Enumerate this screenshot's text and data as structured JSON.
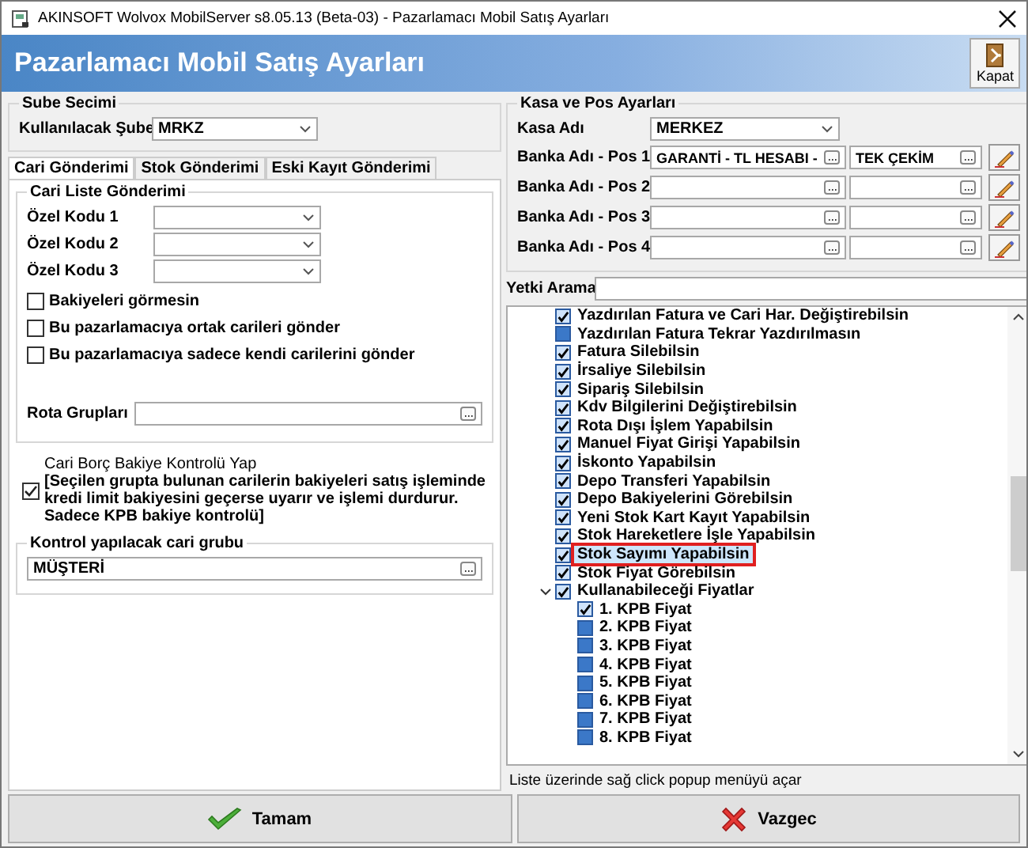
{
  "window": {
    "title": "AKINSOFT Wolvox MobilServer s8.05.13 (Beta-03) - Pazarlamacı Mobil Satış Ayarları"
  },
  "header": {
    "title": "Pazarlamacı Mobil Satış Ayarları",
    "close_button": "Kapat"
  },
  "branch": {
    "group": "Sube Secimi",
    "label": "Kullanılacak Şube",
    "value": "MRKZ"
  },
  "tabs": [
    {
      "label": "Cari Gönderimi",
      "selected": true
    },
    {
      "label": "Stok Gönderimi",
      "selected": false
    },
    {
      "label": "Eski Kayıt Gönderimi",
      "selected": false
    }
  ],
  "customer_list": {
    "group": "Cari Liste Gönderimi",
    "codes": [
      {
        "label": "Özel Kodu 1"
      },
      {
        "label": "Özel Kodu 2"
      },
      {
        "label": "Özel Kodu 3"
      }
    ],
    "options": [
      {
        "label": "Bakiyeleri görmesin",
        "checked": false
      },
      {
        "label": "Bu pazarlamacıya ortak carileri gönder",
        "checked": false
      },
      {
        "label": "Bu pazarlamacıya sadece kendi carilerini gönder",
        "checked": false
      }
    ],
    "route_label": "Rota Grupları"
  },
  "balance_check": {
    "title": "Cari Borç Bakiye Kontrolü Yap",
    "note": "[Seçilen grupta bulunan carilerin bakiyeleri satış işleminde kredi limit bakiyesini geçerse uyarır ve işlemi durdurur. Sadece KPB bakiye kontrolü]",
    "checked": true
  },
  "check_group": {
    "group": "Kontrol yapılacak cari grubu",
    "value": "MÜŞTERİ"
  },
  "cash_pos": {
    "group": "Kasa ve Pos Ayarları",
    "cash_label": "Kasa Adı",
    "cash_value": "MERKEZ",
    "pos": [
      {
        "label": "Banka Adı - Pos 1",
        "bank": "GARANTİ - TL HESABI -",
        "plan": "TEK ÇEKİM"
      },
      {
        "label": "Banka Adı - Pos 2"
      },
      {
        "label": "Banka Adı - Pos 3"
      },
      {
        "label": "Banka Adı - Pos 4"
      }
    ]
  },
  "search": {
    "label": "Yetki Arama"
  },
  "permissions": [
    {
      "label": "Yazdırılan Fatura ve Cari Har. Değiştirebilsin",
      "checked": true,
      "selected": false
    },
    {
      "label": "Yazdırılan Fatura Tekrar Yazdırılmasın",
      "checked": false,
      "selected": false
    },
    {
      "label": "Fatura Silebilsin",
      "checked": true,
      "selected": false
    },
    {
      "label": "İrsaliye Silebilsin",
      "checked": true,
      "selected": false
    },
    {
      "label": "Sipariş Silebilsin",
      "checked": true,
      "selected": false
    },
    {
      "label": "Kdv Bilgilerini Değiştirebilsin",
      "checked": true,
      "selected": false
    },
    {
      "label": "Rota Dışı İşlem Yapabilsin",
      "checked": true,
      "selected": false
    },
    {
      "label": "Manuel Fiyat Girişi Yapabilsin",
      "checked": true,
      "selected": false
    },
    {
      "label": "İskonto Yapabilsin",
      "checked": true,
      "selected": false
    },
    {
      "label": "Depo Transferi Yapabilsin",
      "checked": true,
      "selected": false
    },
    {
      "label": "Depo Bakiyelerini Görebilsin",
      "checked": true,
      "selected": false
    },
    {
      "label": "Yeni Stok Kart Kayıt Yapabilsin",
      "checked": true,
      "selected": false
    },
    {
      "label": "Stok Hareketlere İşle Yapabilsin",
      "checked": true,
      "selected": false
    },
    {
      "label": "Stok Sayımı Yapabilsin",
      "checked": true,
      "selected": true
    },
    {
      "label": "Stok Fiyat Görebilsin",
      "checked": true,
      "selected": false
    },
    {
      "label": "Kullanabileceği Fiyatlar",
      "checked": true,
      "selected": false,
      "expanded": true,
      "children": [
        {
          "label": "1. KPB Fiyat",
          "checked": true,
          "selected": false
        },
        {
          "label": "2. KPB Fiyat",
          "checked": false,
          "selected": false
        },
        {
          "label": "3. KPB Fiyat",
          "checked": false,
          "selected": false
        },
        {
          "label": "4. KPB Fiyat",
          "checked": false,
          "selected": false
        },
        {
          "label": "5. KPB Fiyat",
          "checked": false,
          "selected": false
        },
        {
          "label": "6. KPB Fiyat",
          "checked": false,
          "selected": false
        },
        {
          "label": "7. KPB Fiyat",
          "checked": false,
          "selected": false
        },
        {
          "label": "8. KPB Fiyat",
          "checked": false,
          "selected": false
        }
      ]
    }
  ],
  "status_text": "Liste üzerinde sağ click popup menüyü açar",
  "buttons": [
    {
      "kind": "ok",
      "label": "Tamam"
    },
    {
      "kind": "cancel",
      "label": "Vazgec"
    }
  ]
}
